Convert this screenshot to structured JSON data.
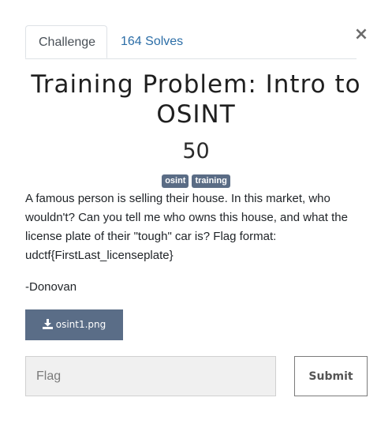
{
  "tabs": [
    {
      "label": "Challenge",
      "active": true
    },
    {
      "label": "164 Solves",
      "active": false
    }
  ],
  "close_icon": "×",
  "challenge": {
    "title": "Training Problem: Intro to OSINT",
    "value": "50",
    "tags": [
      "osint",
      "training"
    ],
    "description": [
      "A famous person is selling their house. In this market, who wouldn't? Can you tell me who owns this house, and what the license plate of their \"tough\" car is? Flag format: udctf{FirstLast_licenseplate}",
      "-Donovan"
    ],
    "file": {
      "label": "osint1.png",
      "icon": "download-icon"
    }
  },
  "form": {
    "flag_placeholder": "Flag",
    "flag_value": "",
    "submit_label": "Submit"
  },
  "colors": {
    "tag_bg": "#5a6c85",
    "file_button_bg": "#5a6d87",
    "tab_link": "#2c6ea7"
  }
}
